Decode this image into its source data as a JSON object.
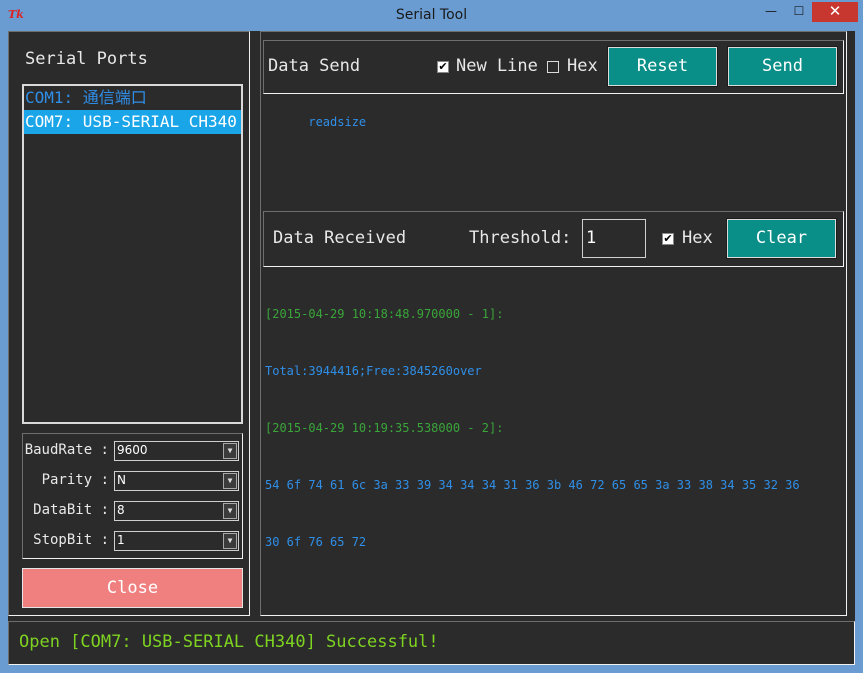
{
  "window": {
    "title": "Serial Tool",
    "icon": "Tk",
    "buttons": {
      "minimize": "—",
      "maximize": "☐",
      "close": "✕"
    }
  },
  "ports": {
    "heading": "Serial Ports",
    "items": [
      "COM1: 通信端口",
      "COM7: USB-SERIAL CH340"
    ],
    "selected": "COM7: USB-SERIAL CH340"
  },
  "config": {
    "baudrate": {
      "label": "BaudRate :",
      "value": "9600"
    },
    "parity": {
      "label": "Parity :",
      "value": "N"
    },
    "databit": {
      "label": "DataBit :",
      "value": "8"
    },
    "stopbit": {
      "label": "StopBit :",
      "value": "1"
    }
  },
  "close_button": "Close",
  "send": {
    "title": "Data Send",
    "newline_label": "New Line",
    "newline_checked": "✔",
    "hex_label": "Hex",
    "reset_label": "Reset",
    "send_label": "Send",
    "text": "readsize"
  },
  "receive": {
    "title": "Data Received",
    "threshold_label": "Threshold:",
    "threshold_value": "1",
    "hex_label": "Hex",
    "hex_checked": "✔",
    "clear_label": "Clear",
    "lines": [
      {
        "text": "[2015-04-29 10:18:48.970000 - 1]:",
        "kind": "header"
      },
      {
        "text": "Total:3944416;Free:3845260over",
        "kind": "data"
      },
      {
        "text": "[2015-04-29 10:19:35.538000 - 2]:",
        "kind": "header"
      },
      {
        "text": "54 6f 74 61 6c 3a 33 39 34 34 34 31 36 3b 46 72 65 65 3a 33 38 34 35 32 36",
        "kind": "data"
      },
      {
        "text": "30 6f 76 65 72",
        "kind": "data"
      }
    ]
  },
  "status": {
    "message": "Open [COM7: USB-SERIAL CH340] Successful!"
  },
  "colors": {
    "background": "#2b2b2b",
    "accent_teal": "#0a8e88",
    "close_red": "#f08080",
    "status_green": "#7ed321",
    "text_blue": "#2f8fe8",
    "header_green": "#3aa53a",
    "selection": "#1aa5e8"
  }
}
